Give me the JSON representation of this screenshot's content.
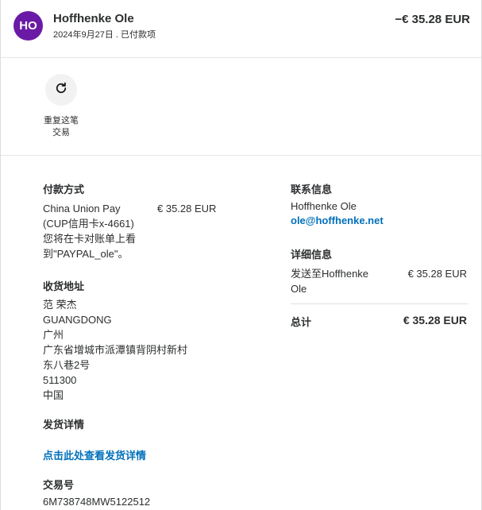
{
  "header": {
    "avatar_initials": "HO",
    "avatar_color": "#6b1aa6",
    "merchant_name": "Hoffhenke Ole",
    "date_status": "2024年9月27日 . 已付款项",
    "amount": "−€ 35.28 EUR"
  },
  "actions": {
    "repeat_icon": "refresh-icon",
    "repeat_label_line1": "重复这笔",
    "repeat_label_line2": "交易"
  },
  "payment": {
    "heading": "付款方式",
    "method_line1": "China Union Pay",
    "method_line2": "(CUP信用卡x-4661)",
    "method_line3": "您将在卡对账单上看",
    "method_line4": "到\"PAYPAL_ole\"。",
    "amount": "€ 35.28 EUR"
  },
  "shipping_address": {
    "heading": "收货地址",
    "lines": [
      "范 荣杰",
      "GUANGDONG",
      "广州",
      "广东省增城市派潭镇背阴村新村",
      "东八巷2号",
      "511300",
      "中国"
    ]
  },
  "shipping_details": {
    "heading": "发货详情",
    "link": "点击此处查看发货详情"
  },
  "transaction": {
    "heading": "交易号",
    "id": "6M738748MW5122512"
  },
  "contact": {
    "heading": "联系信息",
    "name": "Hoffhenke Ole",
    "email": "ole@hoffhenke.net"
  },
  "details": {
    "heading": "详细信息",
    "sent_to_line1": "发送至Hoffhenke",
    "sent_to_line2": "Ole",
    "amount": "€ 35.28 EUR",
    "total_label": "总计",
    "total_amount": "€ 35.28 EUR"
  },
  "colors": {
    "link": "#0070ba",
    "avatar": "#6b1aa6"
  }
}
